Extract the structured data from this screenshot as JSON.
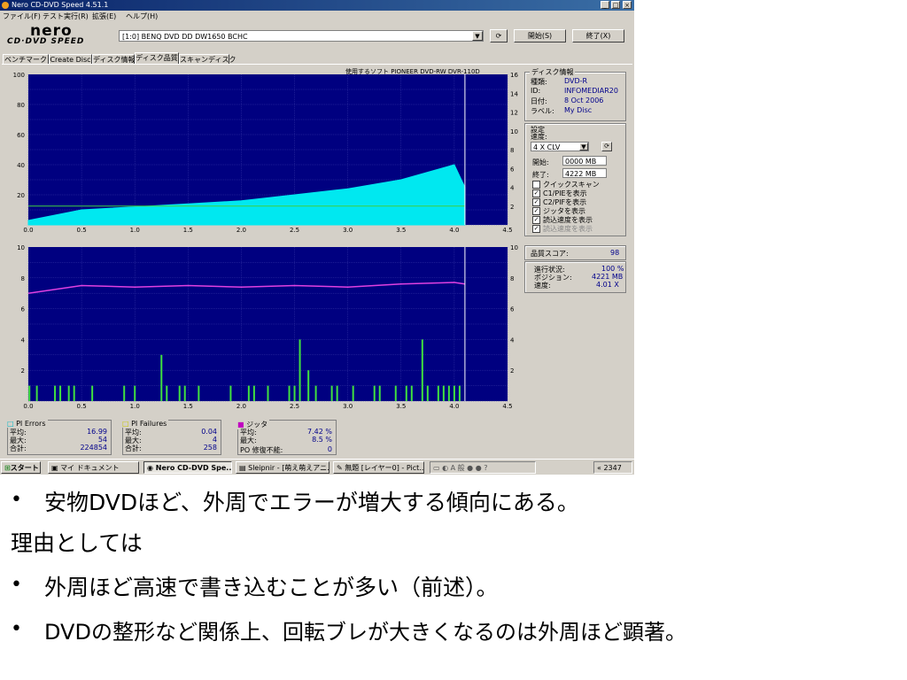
{
  "window": {
    "title": "Nero CD-DVD Speed 4.51.1",
    "menu": [
      "ファイル(F)",
      "テスト実行(R)",
      "拡張(E)",
      "ヘルプ(H)"
    ],
    "logo_top": "nero",
    "logo_bottom": "CD·DVD SPEED",
    "drive_select": "[1:0]   BENQ DVD DD DW1650 BCHC",
    "start_button": "開始(S)",
    "exit_button": "終了(X)",
    "tabs": [
      "ベンチマーク",
      "Create Disc",
      "ディスク情報",
      "ディスク品質",
      "スキャンディスク"
    ],
    "active_tab": 3,
    "recording_software": "使用するソフト PIONEER  DVD-RW  DVR-110D"
  },
  "disc_info": {
    "header": "ディスク情報",
    "type_label": "種類:",
    "type_value": "DVD-R",
    "id_label": "ID:",
    "id_value": "INFOMEDIAR20",
    "date_label": "日付:",
    "date_value": "8 Oct 2006",
    "label_label": "ラベル:",
    "label_value": "My Disc"
  },
  "settings": {
    "header": "設定",
    "speed_label": "速度:",
    "speed_value": "4 X CLV",
    "start_label": "開始:",
    "start_value": "0000 MB",
    "end_label": "終了:",
    "end_value": "4222 MB",
    "checkboxes": [
      {
        "label": "クイックスキャン",
        "checked": false
      },
      {
        "label": "C1/PIEを表示",
        "checked": true
      },
      {
        "label": "C2/PIFを表示",
        "checked": true
      },
      {
        "label": "ジッタを表示",
        "checked": true
      },
      {
        "label": "読込速度を表示",
        "checked": true
      },
      {
        "label": "読込速度を表示",
        "checked": true,
        "disabled": true
      }
    ]
  },
  "quality": {
    "label": "品質スコア:",
    "value": "98"
  },
  "progress": {
    "status_label": "進行状況:",
    "status_value": "100 %",
    "position_label": "ポジション:",
    "position_value": "4221 MB",
    "speed_label": "速度:",
    "speed_value": "4.01 X"
  },
  "stats": {
    "pi_errors": {
      "title": "PI Errors",
      "avg_label": "平均:",
      "avg": "16.99",
      "max_label": "最大:",
      "max": "54",
      "total_label": "合計:",
      "total": "224854"
    },
    "pi_failures": {
      "title": "PI Failures",
      "avg_label": "平均:",
      "avg": "0.04",
      "max_label": "最大:",
      "max": "4",
      "total_label": "合計:",
      "total": "258"
    },
    "jitter": {
      "title": "ジッタ",
      "avg_label": "平均:",
      "avg": "7.42 %",
      "max_label": "最大:",
      "max": "8.5 %",
      "po_label": "PO 修復不能:",
      "po": "0"
    }
  },
  "taskbar": {
    "start": "スタート",
    "items": [
      "マイ ドキュメント",
      "Nero CD-DVD Spe...",
      "Sleipnir - [萌え萌えアニ...",
      "無題 [レイヤー0] - Pict..."
    ],
    "clock": "2347"
  },
  "chart_data": [
    {
      "type": "area",
      "title": "",
      "x": [
        0.0,
        0.5,
        1.0,
        1.5,
        2.0,
        2.5,
        3.0,
        3.5,
        4.0,
        4.1
      ],
      "series": [
        {
          "name": "PI Errors",
          "values": [
            3,
            10,
            12,
            14,
            16,
            20,
            24,
            30,
            40,
            25
          ]
        },
        {
          "name": "",
          "values": [
            2,
            2,
            2,
            2,
            2,
            2,
            2,
            2,
            2,
            2
          ]
        }
      ],
      "xlim": [
        0.0,
        4.5
      ],
      "ylim_left": [
        0,
        100
      ],
      "ylim_right": [
        0,
        16
      ],
      "x_ticks": [
        "0.0",
        "0.5",
        "1.0",
        "1.5",
        "2.0",
        "2.5",
        "3.0",
        "3.5",
        "4.0",
        "4.5"
      ],
      "y_ticks_left": [
        "100",
        "80",
        "60",
        "40",
        "20"
      ],
      "y_ticks_right": [
        "16",
        "14",
        "12",
        "10",
        "8",
        "6",
        "4",
        "2"
      ]
    },
    {
      "type": "bar",
      "title": "",
      "series": [
        {
          "name": "PI Failures",
          "x": [
            0.01,
            0.08,
            0.25,
            0.3,
            0.38,
            0.43,
            0.6,
            0.9,
            1.0,
            1.25,
            1.3,
            1.42,
            1.47,
            1.6,
            1.9,
            2.07,
            2.12,
            2.25,
            2.45,
            2.5,
            2.55,
            2.63,
            2.7,
            2.85,
            2.9,
            3.05,
            3.25,
            3.3,
            3.45,
            3.55,
            3.6,
            3.7,
            3.75,
            3.85,
            3.9,
            3.95,
            4.0,
            4.05
          ],
          "values": [
            1,
            1,
            1,
            1,
            1,
            1,
            1,
            1,
            1,
            3,
            1,
            1,
            1,
            1,
            1,
            1,
            1,
            1,
            1,
            1,
            4,
            2,
            1,
            1,
            1,
            1,
            1,
            1,
            1,
            1,
            1,
            4,
            1,
            1,
            1,
            1,
            1,
            1
          ]
        },
        {
          "name": "ジッタ",
          "x": [
            0.0,
            0.5,
            1.0,
            1.5,
            2.0,
            2.5,
            3.0,
            3.5,
            4.0,
            4.1
          ],
          "values": [
            7.0,
            7.5,
            7.4,
            7.5,
            7.4,
            7.5,
            7.4,
            7.6,
            7.7,
            7.6
          ]
        }
      ],
      "xlim": [
        0.0,
        4.5
      ],
      "ylim_left": [
        0,
        10
      ],
      "ylim_right": [
        0,
        10
      ],
      "x_ticks": [
        "0.0",
        "0.5",
        "1.0",
        "1.5",
        "2.0",
        "2.5",
        "3.0",
        "3.5",
        "4.0",
        "4.5"
      ],
      "y_ticks_left": [
        "10",
        "8",
        "6",
        "4",
        "2"
      ],
      "y_ticks_right": [
        "10",
        "8",
        "6",
        "4",
        "2"
      ]
    }
  ],
  "slide": {
    "line1": "安物DVDほど、外周でエラーが増大する傾向にある。",
    "line2": "理由としては",
    "line3": "外周ほど高速で書き込むことが多い（前述）。",
    "line4": "DVDの整形など関係上、回転ブレが大きくなるのは外周ほど顕著。",
    "bullet": "•"
  }
}
